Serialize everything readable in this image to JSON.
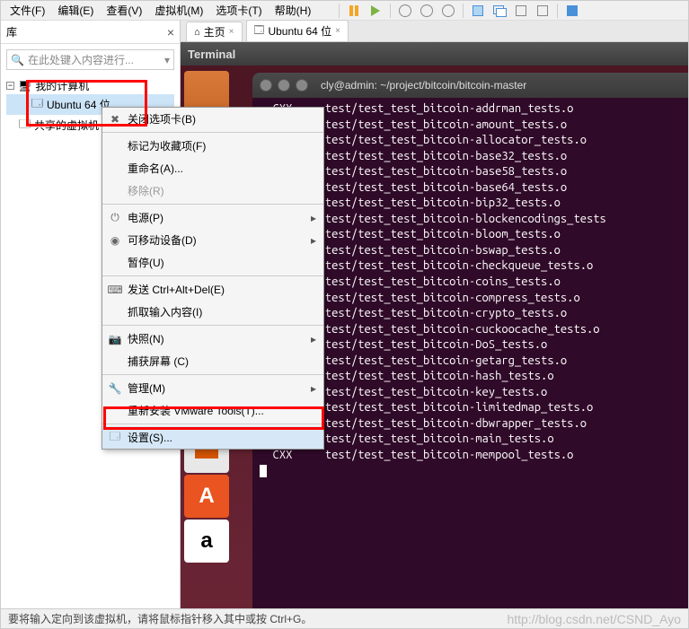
{
  "menubar": [
    "文件(F)",
    "编辑(E)",
    "查看(V)",
    "虚拟机(M)",
    "选项卡(T)",
    "帮助(H)"
  ],
  "library": {
    "title": "库",
    "search_placeholder": "在此处键入内容进行...",
    "tree": {
      "root": "我的计算机",
      "child1": "Ubuntu 64 位",
      "child2": "共享的虚拟机"
    }
  },
  "tabs": {
    "home": "主页",
    "vm": "Ubuntu 64 位"
  },
  "terminal": {
    "app_title": "Terminal",
    "win_title": "cly@admin: ~/project/bitcoin/bitcoin-master",
    "prefix": "CXX",
    "lines": [
      "test/test_test_bitcoin-addrman_tests.o",
      "test/test_test_bitcoin-amount_tests.o",
      "test/test_test_bitcoin-allocator_tests.o",
      "test/test_test_bitcoin-base32_tests.o",
      "test/test_test_bitcoin-base58_tests.o",
      "test/test_test_bitcoin-base64_tests.o",
      "test/test_test_bitcoin-bip32_tests.o",
      "test/test_test_bitcoin-blockencodings_tests",
      "test/test_test_bitcoin-bloom_tests.o",
      "test/test_test_bitcoin-bswap_tests.o",
      "test/test_test_bitcoin-checkqueue_tests.o",
      "test/test_test_bitcoin-coins_tests.o",
      "test/test_test_bitcoin-compress_tests.o",
      "test/test_test_bitcoin-crypto_tests.o",
      "test/test_test_bitcoin-cuckoocache_tests.o",
      "test/test_test_bitcoin-DoS_tests.o",
      "test/test_test_bitcoin-getarg_tests.o",
      "test/test_test_bitcoin-hash_tests.o",
      "test/test_test_bitcoin-key_tests.o",
      "test/test_test_bitcoin-limitedmap_tests.o",
      "test/test_test_bitcoin-dbwrapper_tests.o",
      "test/test_test_bitcoin-main_tests.o",
      "test/test_test_bitcoin-mempool_tests.o"
    ]
  },
  "context_menu": {
    "close_tab": "关闭选项卡(B)",
    "favorite": "标记为收藏项(F)",
    "rename": "重命名(A)...",
    "remove": "移除(R)",
    "power": "电源(P)",
    "removable": "可移动设备(D)",
    "pause": "暂停(U)",
    "send_cad": "发送 Ctrl+Alt+Del(E)",
    "grab_input": "抓取输入内容(I)",
    "snapshot": "快照(N)",
    "capture": "捕获屏幕 (C)",
    "manage": "管理(M)",
    "reinstall_tools": "重新安装 VMware Tools(T)...",
    "settings": "设置(S)..."
  },
  "status": {
    "text": "要将输入定向到该虚拟机，请将鼠标指针移入其中或按 Ctrl+G。",
    "watermark": "http://blog.csdn.net/CSND_Ayo"
  }
}
